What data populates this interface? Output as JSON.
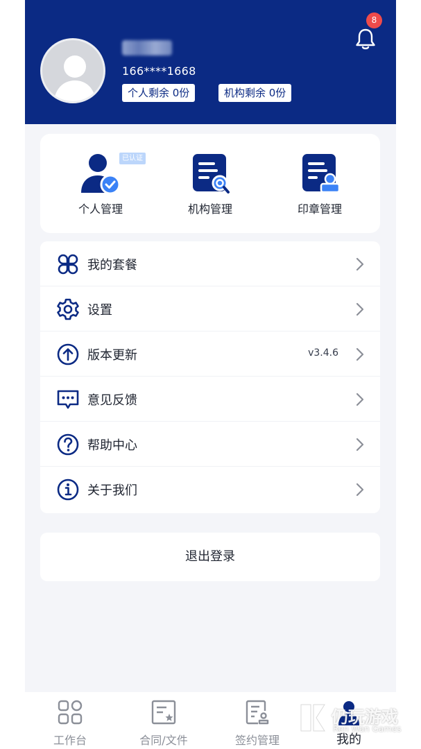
{
  "header": {
    "phone": "166****1668",
    "quota_personal": "个人剩余 0份",
    "quota_org": "机构剩余 0份",
    "notification_count": "8"
  },
  "management": {
    "verified_badge": "已认证",
    "items": [
      {
        "label": "个人管理",
        "icon": "person-check-icon"
      },
      {
        "label": "机构管理",
        "icon": "document-search-icon"
      },
      {
        "label": "印章管理",
        "icon": "document-stamp-icon"
      }
    ]
  },
  "menu": {
    "items": [
      {
        "label": "我的套餐",
        "icon": "grid-petals-icon"
      },
      {
        "label": "设置",
        "icon": "gear-icon"
      },
      {
        "label": "版本更新",
        "icon": "upload-circle-icon",
        "value": "v3.4.6"
      },
      {
        "label": "意见反馈",
        "icon": "chat-bubble-icon"
      },
      {
        "label": "帮助中心",
        "icon": "question-circle-icon"
      },
      {
        "label": "关于我们",
        "icon": "info-circle-icon"
      }
    ]
  },
  "logout_label": "退出登录",
  "tabbar": {
    "items": [
      {
        "label": "工作台",
        "icon": "dashboard-grid-icon"
      },
      {
        "label": "合同/文件",
        "icon": "contract-file-icon"
      },
      {
        "label": "签约管理",
        "icon": "sign-manage-icon"
      },
      {
        "label": "我的",
        "icon": "profile-icon",
        "active": true
      }
    ]
  },
  "watermark": {
    "cn": "仍玩游戏",
    "en": "Ren Wan Games"
  },
  "colors": {
    "brand": "#0b2a84",
    "accent": "#3b82f6",
    "badge": "#ef4b4b",
    "background": "#f4f5f9"
  }
}
